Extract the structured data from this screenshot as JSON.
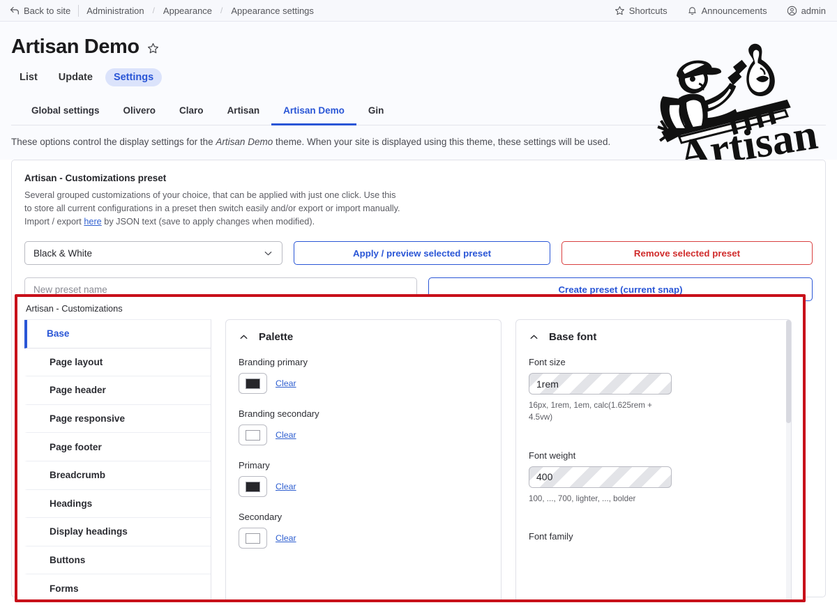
{
  "toolbar": {
    "back_label": "Back to site",
    "breadcrumbs": [
      "Administration",
      "Appearance",
      "Appearance settings"
    ],
    "shortcuts_label": "Shortcuts",
    "announcements_label": "Announcements",
    "account_label": "admin"
  },
  "header": {
    "title": "Artisan Demo",
    "primary_tabs": [
      {
        "label": "List",
        "active": false
      },
      {
        "label": "Update",
        "active": false
      },
      {
        "label": "Settings",
        "active": true
      }
    ],
    "theme_tabs": [
      {
        "label": "Global settings",
        "active": false
      },
      {
        "label": "Olivero",
        "active": false
      },
      {
        "label": "Claro",
        "active": false
      },
      {
        "label": "Artisan",
        "active": false
      },
      {
        "label": "Artisan Demo",
        "active": true
      },
      {
        "label": "Gin",
        "active": false
      }
    ],
    "description_pre": "These options control the display settings for the ",
    "description_em": "Artisan Demo",
    "description_post": " theme. When your site is displayed using this theme, these settings will be used.",
    "logo_text": "Artisan"
  },
  "preset": {
    "heading": "Artisan - Customizations preset",
    "body_line1": "Several grouped customizations of your choice, that can be applied with just one click. Use this to store",
    "body_line2": "all current configurations in a preset then switch easily and/or export or import manually. Import / export",
    "body_link": "here",
    "body_line3": " by JSON text (save to apply changes when modified).",
    "select_value": "Black & White",
    "apply_button": "Apply / preview selected preset",
    "remove_button": "Remove selected preset",
    "new_name_placeholder": "New preset name",
    "new_name_value": "",
    "create_button": "Create preset (current snap)"
  },
  "customizations": {
    "title": "Artisan - Customizations",
    "menu": [
      {
        "label": "Base",
        "active": true
      },
      {
        "label": "Page layout",
        "active": false
      },
      {
        "label": "Page header",
        "active": false
      },
      {
        "label": "Page responsive",
        "active": false
      },
      {
        "label": "Page footer",
        "active": false
      },
      {
        "label": "Breadcrumb",
        "active": false
      },
      {
        "label": "Headings",
        "active": false
      },
      {
        "label": "Display headings",
        "active": false
      },
      {
        "label": "Buttons",
        "active": false
      },
      {
        "label": "Forms",
        "active": false
      }
    ],
    "palette": {
      "title": "Palette",
      "clear_label": "Clear",
      "items": [
        {
          "label": "Branding primary",
          "color": "#26262a"
        },
        {
          "label": "Branding secondary",
          "color": "#ffffff"
        },
        {
          "label": "Primary",
          "color": "#26262a"
        },
        {
          "label": "Secondary",
          "color": "#ffffff"
        }
      ]
    },
    "base_font": {
      "title": "Base font",
      "font_size_label": "Font size",
      "font_size_value": "1rem",
      "font_size_help": "16px, 1rem, 1em, calc(1.625rem + 4.5vw)",
      "font_weight_label": "Font weight",
      "font_weight_value": "400",
      "font_weight_help": "100, ..., 700, lighter, ..., bolder",
      "font_family_label": "Font family"
    }
  },
  "colors": {
    "accent": "#2a56d6",
    "danger": "#d02c2c",
    "highlight_border": "#c8101a"
  }
}
